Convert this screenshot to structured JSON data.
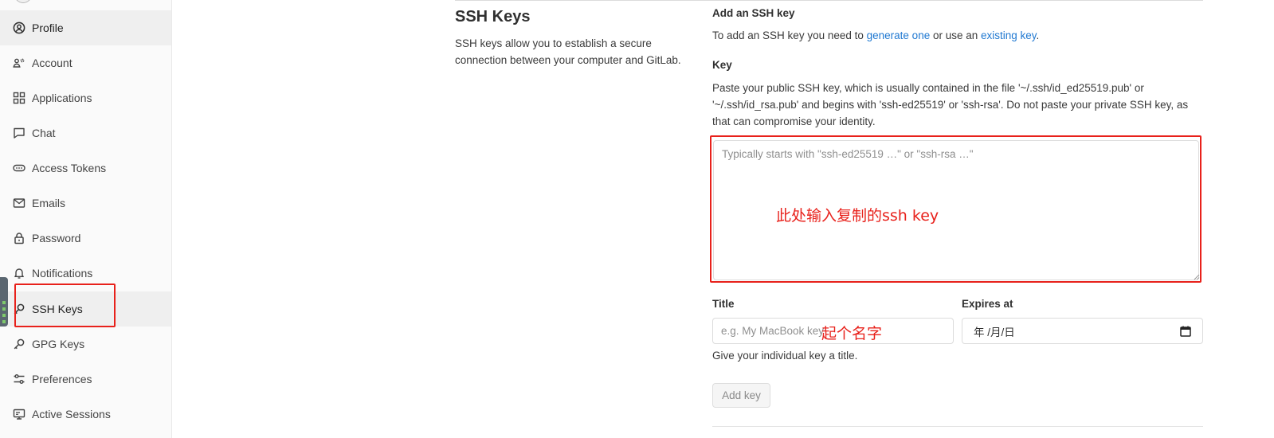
{
  "sidebar": {
    "items": [
      {
        "label": "Profile",
        "icon": "profile-icon",
        "active": true
      },
      {
        "label": "Account",
        "icon": "account-icon",
        "active": false
      },
      {
        "label": "Applications",
        "icon": "applications-icon",
        "active": false
      },
      {
        "label": "Chat",
        "icon": "chat-icon",
        "active": false
      },
      {
        "label": "Access Tokens",
        "icon": "token-icon",
        "active": false
      },
      {
        "label": "Emails",
        "icon": "mail-icon",
        "active": false
      },
      {
        "label": "Password",
        "icon": "lock-icon",
        "active": false
      },
      {
        "label": "Notifications",
        "icon": "bell-icon",
        "active": false
      },
      {
        "label": "SSH Keys",
        "icon": "key-icon",
        "active": true
      },
      {
        "label": "GPG Keys",
        "icon": "key-icon",
        "active": false
      },
      {
        "label": "Preferences",
        "icon": "preferences-icon",
        "active": false
      },
      {
        "label": "Active Sessions",
        "icon": "monitor-icon",
        "active": false
      }
    ]
  },
  "section": {
    "title": "SSH Keys",
    "description": "SSH keys allow you to establish a secure connection between your computer and GitLab."
  },
  "add_key": {
    "heading": "Add an SSH key",
    "intro_before": "To add an SSH key you need to ",
    "link_generate": "generate one",
    "intro_middle": " or use an ",
    "link_existing": "existing key",
    "intro_after": "."
  },
  "key_field": {
    "label": "Key",
    "help": "Paste your public SSH key, which is usually contained in the file '~/.ssh/id_ed25519.pub' or '~/.ssh/id_rsa.pub' and begins with 'ssh-ed25519' or 'ssh-rsa'. Do not paste your private SSH key, as that can compromise your identity.",
    "placeholder": "Typically starts with \"ssh-ed25519 …\" or \"ssh-rsa …\""
  },
  "title_field": {
    "label": "Title",
    "placeholder": "e.g. My MacBook key",
    "help": "Give your individual key a title."
  },
  "expires_field": {
    "label": "Expires at",
    "placeholder": "年 /月/日"
  },
  "button": {
    "add_key": "Add key"
  },
  "annotations": {
    "key_note": "此处输入复制的ssh key",
    "title_note": "起个名字",
    "color": "#e8211b"
  },
  "colors": {
    "link": "#1f78d1",
    "sidebar_bg": "#fafafa",
    "active_bg": "#efefef"
  }
}
